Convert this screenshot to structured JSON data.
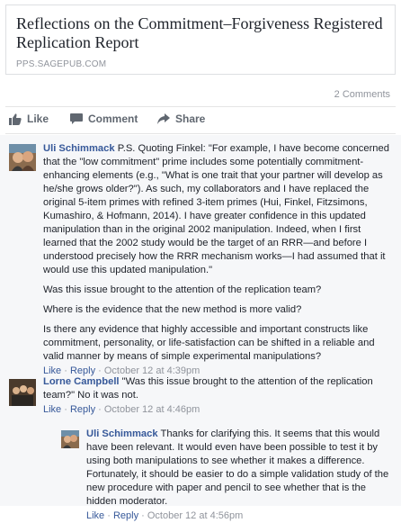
{
  "link_preview": {
    "title": "Reflections on the Commitment–Forgiveness Registered Replication Report",
    "domain": "PPS.SAGEPUB.COM"
  },
  "comments_count": "2 Comments",
  "actions": {
    "like": "Like",
    "comment": "Comment",
    "share": "Share"
  },
  "comments": [
    {
      "author": "Uli Schimmack",
      "paragraphs": [
        "P.S. Quoting Finkel: \"For example, I have become concerned that the \"low commitment\" prime includes some potentially commitment-enhancing elements (e.g., \"What is one trait that your partner will develop as he/she grows older?\"). As such, my collaborators and I have replaced the original 5-item primes with refined 3-item primes (Hui, Finkel, Fitzsimons, Kumashiro, & Hofmann, 2014). I have greater confidence in this updated manipulation than in the original 2002 manipulation. Indeed, when I first learned that the 2002 study would be the target of an RRR—and before I understood precisely how the RRR mechanism works—I had assumed that it would use this updated manipulation.\"",
        "Was this issue brought to the attention of the replication team?",
        "Where is the evidence that the new method is more valid?",
        "Is there any evidence that highly accessible and important constructs like commitment, personality, or life-satisfaction can be shifted in a reliable and valid manner by means of simple experimental manipulations?"
      ],
      "like": "Like",
      "reply": "Reply",
      "timestamp": "October 12 at 4:39pm"
    },
    {
      "author": "Lorne Campbell",
      "text": "\"Was this issue brought to the attention of the replication team?\" No it was not.",
      "like": "Like",
      "reply": "Reply",
      "timestamp": "October 12 at 4:46pm"
    },
    {
      "author": "Uli Schimmack",
      "text": "Thanks for clarifying this. It seems that this would have been relevant. It would even have been possible to test it by using both manipulations to see whether it makes a difference. Fortunately, it should be easier to do a simple validation study of the new procedure with paper and pencil to see whether that is the hidden moderator.",
      "like": "Like",
      "reply": "Reply",
      "timestamp": "October 12 at 4:56pm"
    }
  ],
  "colors": {
    "link_blue": "#365899",
    "muted_gray": "#90949c",
    "action_gray": "#606770",
    "comment_bg": "#f6f7f9"
  }
}
